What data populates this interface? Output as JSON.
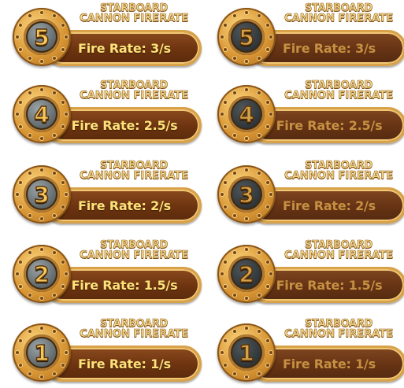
{
  "title_line1": "STARBOARD",
  "title_line2": "CANNON FIRERATE",
  "upgrades": [
    {
      "level": "5",
      "rate_text": "Fire Rate: 3/s"
    },
    {
      "level": "4",
      "rate_text": "Fire Rate: 2.5/s"
    },
    {
      "level": "3",
      "rate_text": "Fire Rate: 2/s"
    },
    {
      "level": "2",
      "rate_text": "Fire Rate: 1.5/s"
    },
    {
      "level": "1",
      "rate_text": "Fire Rate: 1/s"
    }
  ],
  "states": [
    "active",
    "inactive"
  ],
  "colors": {
    "pill_fill": "#6d3410",
    "pill_border": "#d8a24a",
    "rate_text_active": "#fde27a",
    "rate_text_inactive": "#c69042",
    "title_text": "#f6d98a",
    "medallion_gold": "#d89634",
    "face_active": "#5e6669",
    "face_inactive": "#2c3235"
  },
  "icons": {
    "medallion": "numbered-gold-medallion-icon"
  }
}
